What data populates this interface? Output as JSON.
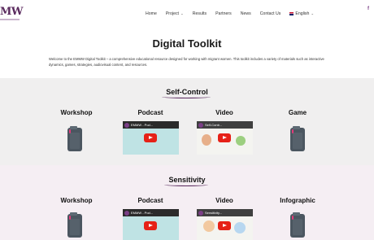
{
  "header": {
    "logo": "MW",
    "nav": [
      {
        "label": "Home",
        "dropdown": false
      },
      {
        "label": "Project",
        "dropdown": true
      },
      {
        "label": "Results",
        "dropdown": false
      },
      {
        "label": "Partners",
        "dropdown": false
      },
      {
        "label": "News",
        "dropdown": false
      },
      {
        "label": "Contact Us",
        "dropdown": false
      }
    ],
    "language": "English",
    "social_icon": "facebook-icon"
  },
  "page": {
    "title": "Digital Toolkit",
    "intro": "Welcome to the EMMW Digital Toolkit – a comprehensive educational resource designed for working with migrant women. This toolkit includes a variety of materials such as interactive dynamics, games, strategies, audiovisual content, and resources."
  },
  "sections": [
    {
      "heading": "Self-Control",
      "columns": [
        {
          "title": "Workshop",
          "kind": "document-icon"
        },
        {
          "title": "Podcast",
          "kind": "video-thumbnail",
          "thumb_title": "EMMW - Pod..."
        },
        {
          "title": "Video",
          "kind": "video-thumbnail",
          "thumb_title": "Self-Contr..."
        },
        {
          "title": "Game",
          "kind": "document-icon"
        }
      ]
    },
    {
      "heading": "Sensitivity",
      "columns": [
        {
          "title": "Workshop",
          "kind": "document-icon"
        },
        {
          "title": "Podcast",
          "kind": "video-thumbnail",
          "thumb_title": "EMMW - Pod..."
        },
        {
          "title": "Video",
          "kind": "video-thumbnail",
          "thumb_title": "Sensitivity..."
        },
        {
          "title": "Infographic",
          "kind": "document-icon"
        }
      ]
    }
  ],
  "colors": {
    "brand": "#5a2a5e",
    "section1_bg": "#f0efef",
    "section2_bg": "#f5eef3",
    "play_button": "#e62117",
    "doc_icon": "#4b5660",
    "doc_accent": "#e23b7a"
  }
}
